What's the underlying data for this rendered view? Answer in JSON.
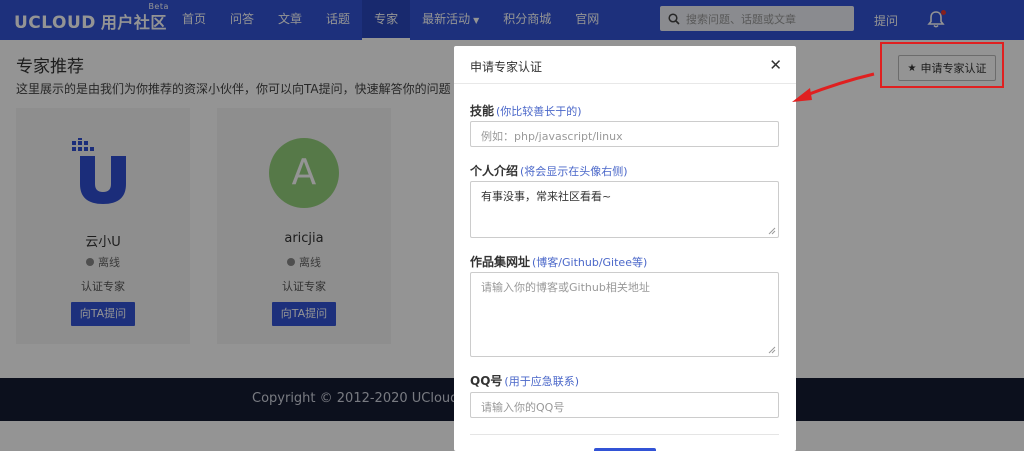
{
  "header": {
    "logo": "UCLOUD",
    "logo_cn": "用户社区",
    "beta": "Beta",
    "nav": [
      {
        "label": "首页"
      },
      {
        "label": "问答"
      },
      {
        "label": "文章"
      },
      {
        "label": "话题"
      },
      {
        "label": "专家",
        "active": true
      },
      {
        "label": "最新活动"
      },
      {
        "label": "积分商城"
      },
      {
        "label": "官网"
      }
    ],
    "search_placeholder": "搜索问题、话题或文章",
    "ask_label": "提问"
  },
  "page": {
    "title": "专家推荐",
    "description": "这里展示的是由我们为你推荐的资深小伙伴，你可以向TA提问，快速解答你的问题",
    "apply_button": "申请专家认证",
    "experts": [
      {
        "name": "云小U",
        "status": "离线",
        "role": "认证专家",
        "ask_button": "向TA提问"
      },
      {
        "name": "aricjia",
        "avatar_letter": "A",
        "status": "离线",
        "role": "认证专家",
        "ask_button": "向TA提问"
      }
    ]
  },
  "footer": {
    "copyright": "Copyright © 2012-2020 UCloud"
  },
  "modal": {
    "title": "申请专家认证",
    "fields": [
      {
        "label": "技能",
        "hint": "(你比较善长于的)",
        "placeholder": "例如：php/javascript/linux",
        "value": ""
      },
      {
        "label": "个人介绍",
        "hint": "(将会显示在头像右侧)",
        "placeholder": "",
        "value": "有事没事，常来社区看看~"
      },
      {
        "label": "作品集网址",
        "hint": "(博客/Github/Gitee等)",
        "placeholder": "请输入你的博客或Github相关地址",
        "value": ""
      },
      {
        "label": "QQ号",
        "hint": "(用于应急联系)",
        "placeholder": "请输入你的QQ号",
        "value": ""
      }
    ]
  },
  "colors": {
    "brand": "#3253d6",
    "highlight": "#e02020",
    "footer": "#161c33"
  }
}
